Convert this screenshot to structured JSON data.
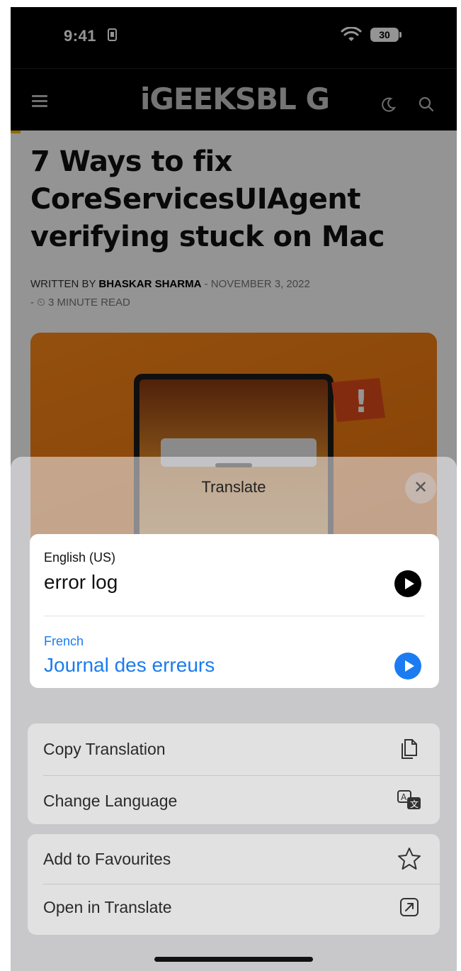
{
  "status_bar": {
    "time": "9:41",
    "battery": "30"
  },
  "site": {
    "logo": "iGEEKSBL G"
  },
  "article": {
    "title": "7 Ways to fix CoreServicesUIAgent verifying stuck on Mac",
    "written_by": "WRITTEN BY",
    "author": "BHASKAR SHARMA",
    "date": "- NOVEMBER 3, 2022",
    "read_time": "- ⏲ 3 MINUTE READ"
  },
  "translate_sheet": {
    "title": "Translate",
    "source_language": "English (US)",
    "source_text": "error log",
    "target_language": "French",
    "target_text": "Journal des erreurs",
    "actions": [
      {
        "label": "Copy Translation",
        "icon": "copy-icon"
      },
      {
        "label": "Change Language",
        "icon": "translate-icon"
      },
      {
        "label": "Add to Favourites",
        "icon": "star-icon"
      },
      {
        "label": "Open in Translate",
        "icon": "open-external-icon"
      }
    ]
  },
  "colors": {
    "accent_blue": "#1a7cf0",
    "hero_orange": "#f07a10"
  }
}
